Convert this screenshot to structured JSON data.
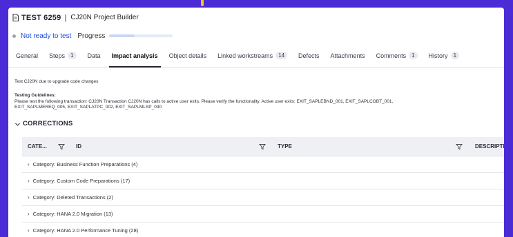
{
  "header": {
    "test_id": "TEST 6259",
    "separator": "|",
    "title": "CJ20N Project Builder"
  },
  "status": {
    "text": "Not ready to test",
    "progress_label": "Progress",
    "progress_value": 0.4
  },
  "tabs": [
    {
      "label": "General",
      "count": null
    },
    {
      "label": "Steps",
      "count": "1"
    },
    {
      "label": "Data",
      "count": null
    },
    {
      "label": "Impact analysis",
      "count": null,
      "active": true
    },
    {
      "label": "Object details",
      "count": null
    },
    {
      "label": "Linked workstreams",
      "count": "14"
    },
    {
      "label": "Defects",
      "count": null
    },
    {
      "label": "Attachments",
      "count": null
    },
    {
      "label": "Comments",
      "count": "1"
    },
    {
      "label": "History",
      "count": "1"
    }
  ],
  "content": {
    "description": "Test CJ20N due to upgrade code changes",
    "guidelines_title": "Testing Guidelines:",
    "guidelines_line1": "Please test the following transaction: CJ20N Transaction CJ20N has calls to active user exits. Please verify the functionality. Active user exits: EXIT_SAPLEBND_001, EXIT_SAPLCOBT_001,",
    "guidelines_line2": "EXIT_SAPLMEREQ_005, EXIT_SAPLATPC_002, EXIT_SAPLMLSP_030"
  },
  "corrections": {
    "heading": "CORRECTIONS",
    "columns": {
      "category": "CATE...",
      "id": "ID",
      "type": "TYPE",
      "description": "DESCRIPTION"
    },
    "rows": [
      "Category: Business Function Preparations (4)",
      "Category: Custom Code Preparations (17)",
      "Category: Deleted Transactions (2)",
      "Category: HANA 2.0 Migration (13)",
      "Category: HANA 2.0 Performance Tuning (28)"
    ]
  },
  "colors": {
    "background": "#4a2bd6",
    "accent": "#f5c518",
    "status_link": "#1d4ed8"
  }
}
